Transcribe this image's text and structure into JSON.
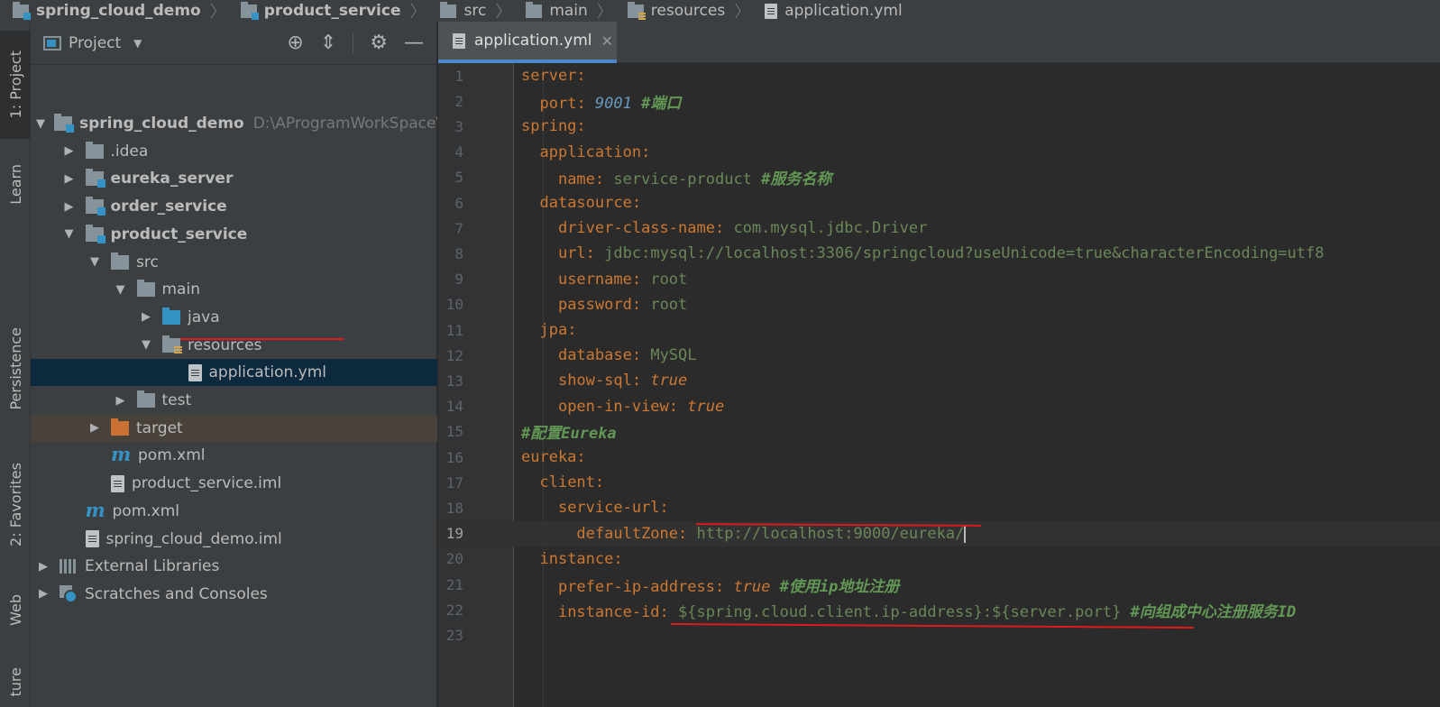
{
  "breadcrumb": [
    {
      "label": "spring_cloud_demo",
      "icon": "module-folder-icon",
      "bold": true
    },
    {
      "label": "product_service",
      "icon": "module-folder-icon",
      "bold": true
    },
    {
      "label": "src",
      "icon": "folder-icon",
      "bold": false
    },
    {
      "label": "main",
      "icon": "folder-icon",
      "bold": false
    },
    {
      "label": "resources",
      "icon": "resources-folder-icon",
      "bold": false
    },
    {
      "label": "application.yml",
      "icon": "yaml-file-icon",
      "bold": false
    }
  ],
  "tool_stripe": {
    "project": "1: Project",
    "learn": "Learn",
    "persistence": "Persistence",
    "favorites": "2: Favorites",
    "web": "Web",
    "structure": "ture"
  },
  "project_panel": {
    "title": "Project",
    "tree": [
      {
        "label": "spring_cloud_demo",
        "path": "D:\\AProgramWorkSpace\\ide",
        "icon": "module-folder-icon",
        "expanded": true,
        "depth": 0,
        "bold": true
      },
      {
        "label": ".idea",
        "icon": "folder-icon",
        "expanded": false,
        "depth": 1,
        "bold": false
      },
      {
        "label": "eureka_server",
        "icon": "module-folder-icon",
        "expanded": false,
        "depth": 1,
        "bold": true
      },
      {
        "label": "order_service",
        "icon": "module-folder-icon",
        "expanded": false,
        "depth": 1,
        "bold": true
      },
      {
        "label": "product_service",
        "icon": "module-folder-icon",
        "expanded": true,
        "depth": 1,
        "bold": true
      },
      {
        "label": "src",
        "icon": "folder-icon",
        "expanded": true,
        "depth": 2,
        "bold": false
      },
      {
        "label": "main",
        "icon": "folder-icon",
        "expanded": true,
        "depth": 3,
        "bold": false
      },
      {
        "label": "java",
        "icon": "source-folder-icon",
        "expanded": false,
        "depth": 4,
        "bold": false
      },
      {
        "label": "resources",
        "icon": "resources-folder-icon",
        "expanded": true,
        "depth": 4,
        "bold": false
      },
      {
        "label": "application.yml",
        "icon": "yaml-file-icon",
        "depth": 5,
        "bold": false,
        "selected": true
      },
      {
        "label": "test",
        "icon": "folder-icon",
        "expanded": false,
        "depth": 3,
        "bold": false
      },
      {
        "label": "target",
        "icon": "excluded-folder-icon",
        "expanded": false,
        "depth": 2,
        "bold": false
      },
      {
        "label": "pom.xml",
        "icon": "maven-icon",
        "depth": 2,
        "bold": false
      },
      {
        "label": "product_service.iml",
        "icon": "iml-file-icon",
        "depth": 2,
        "bold": false
      },
      {
        "label": "pom.xml",
        "icon": "maven-icon",
        "depth": 1,
        "bold": false
      },
      {
        "label": "spring_cloud_demo.iml",
        "icon": "iml-file-icon",
        "depth": 1,
        "bold": false
      },
      {
        "label": "External Libraries",
        "icon": "libraries-icon",
        "expanded": false,
        "depth": 0,
        "bold": false
      },
      {
        "label": "Scratches and Consoles",
        "icon": "scratches-icon",
        "expanded": false,
        "depth": 0,
        "bold": false
      }
    ]
  },
  "editor": {
    "tab_label": "application.yml",
    "current_line": 19,
    "lines": [
      [
        [
          "k",
          "server"
        ],
        [
          "p",
          ":"
        ]
      ],
      [
        [
          "t",
          "  "
        ],
        [
          "k",
          "port"
        ],
        [
          "p",
          ": "
        ],
        [
          "n",
          "9001"
        ],
        [
          "t",
          " "
        ],
        [
          "c",
          "#端口"
        ]
      ],
      [
        [
          "k",
          "spring"
        ],
        [
          "p",
          ":"
        ]
      ],
      [
        [
          "t",
          "  "
        ],
        [
          "k",
          "application"
        ],
        [
          "p",
          ":"
        ]
      ],
      [
        [
          "t",
          "    "
        ],
        [
          "k",
          "name"
        ],
        [
          "p",
          ": "
        ],
        [
          "v",
          "service-product"
        ],
        [
          "t",
          " "
        ],
        [
          "c",
          "#服务名称"
        ]
      ],
      [
        [
          "t",
          "  "
        ],
        [
          "k",
          "datasource"
        ],
        [
          "p",
          ":"
        ]
      ],
      [
        [
          "t",
          "    "
        ],
        [
          "k",
          "driver-class-name"
        ],
        [
          "p",
          ": "
        ],
        [
          "v",
          "com.mysql.jdbc.Driver"
        ]
      ],
      [
        [
          "t",
          "    "
        ],
        [
          "k",
          "url"
        ],
        [
          "p",
          ": "
        ],
        [
          "v",
          "jdbc:mysql://localhost:3306/springcloud?useUnicode=true&characterEncoding=utf8"
        ]
      ],
      [
        [
          "t",
          "    "
        ],
        [
          "k",
          "username"
        ],
        [
          "p",
          ": "
        ],
        [
          "v",
          "root"
        ]
      ],
      [
        [
          "t",
          "    "
        ],
        [
          "k",
          "password"
        ],
        [
          "p",
          ": "
        ],
        [
          "v",
          "root"
        ]
      ],
      [
        [
          "t",
          "  "
        ],
        [
          "k",
          "jpa"
        ],
        [
          "p",
          ":"
        ]
      ],
      [
        [
          "t",
          "    "
        ],
        [
          "k",
          "database"
        ],
        [
          "p",
          ": "
        ],
        [
          "v",
          "MySQL"
        ]
      ],
      [
        [
          "t",
          "    "
        ],
        [
          "k",
          "show-sql"
        ],
        [
          "p",
          ": "
        ],
        [
          "b",
          "true"
        ]
      ],
      [
        [
          "t",
          "    "
        ],
        [
          "k",
          "open-in-view"
        ],
        [
          "p",
          ": "
        ],
        [
          "b",
          "true"
        ]
      ],
      [
        [
          "c",
          "#配置Eureka"
        ]
      ],
      [
        [
          "k",
          "eureka"
        ],
        [
          "p",
          ":"
        ]
      ],
      [
        [
          "t",
          "  "
        ],
        [
          "k",
          "client"
        ],
        [
          "p",
          ":"
        ]
      ],
      [
        [
          "t",
          "    "
        ],
        [
          "k",
          "service-url"
        ],
        [
          "p",
          ":"
        ]
      ],
      [
        [
          "t",
          "      "
        ],
        [
          "k",
          "defaultZone"
        ],
        [
          "p",
          ": "
        ],
        [
          "v",
          "http://localhost:9000/eureka/"
        ]
      ],
      [
        [
          "t",
          "  "
        ],
        [
          "k",
          "instance"
        ],
        [
          "p",
          ":"
        ]
      ],
      [
        [
          "t",
          "    "
        ],
        [
          "k",
          "prefer-ip-address"
        ],
        [
          "p",
          ": "
        ],
        [
          "b",
          "true"
        ],
        [
          "t",
          " "
        ],
        [
          "c",
          "#使用ip地址注册"
        ]
      ],
      [
        [
          "t",
          "    "
        ],
        [
          "k",
          "instance-id"
        ],
        [
          "p",
          ": "
        ],
        [
          "v",
          "${spring.cloud.client.ip-address}:${server.port}"
        ],
        [
          "t",
          " "
        ],
        [
          "c",
          "#向组成中心注册服务ID"
        ]
      ],
      []
    ]
  }
}
